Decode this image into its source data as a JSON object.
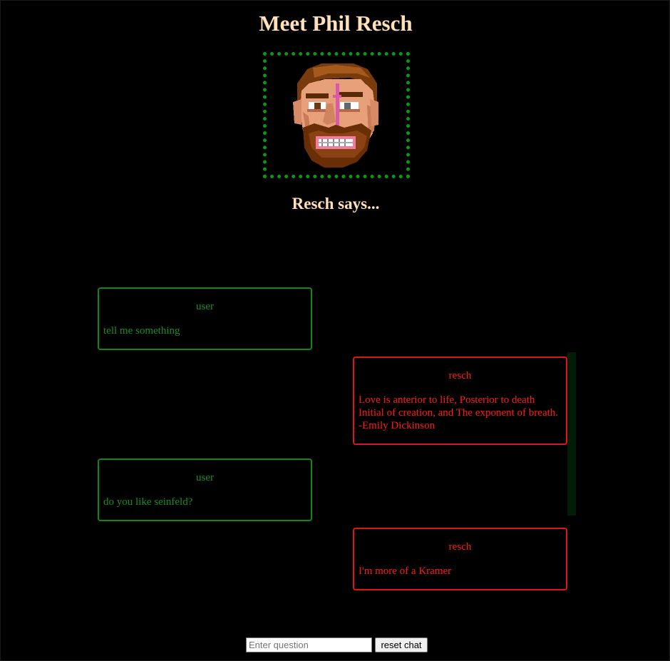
{
  "page": {
    "title": "Meet Phil Resch",
    "subtitle": "Resch says..."
  },
  "portrait": {
    "icon": "phil-resch-pixel-portrait",
    "frame_color": "#0a9a12"
  },
  "colors": {
    "background": "#000000",
    "heading": "#ffe0b8",
    "user": "#1a8f22",
    "bot": "#ff1a1a"
  },
  "messages": [
    {
      "role": "user",
      "speaker": "user",
      "text": "tell me something"
    },
    {
      "role": "bot",
      "speaker": "resch",
      "text": "Love is anterior to life, Posterior to death Initial of creation, and The exponent of breath. -Emily Dickinson"
    },
    {
      "role": "user",
      "speaker": "user",
      "text": "do you like seinfeld?"
    },
    {
      "role": "bot",
      "speaker": "resch",
      "text": "I'm more of a Kramer"
    }
  ],
  "controls": {
    "question_placeholder": "Enter question",
    "question_value": "",
    "reset_label": "reset chat"
  }
}
